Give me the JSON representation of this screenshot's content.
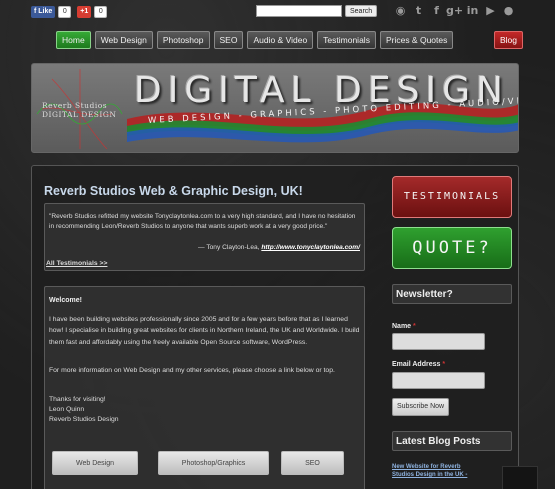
{
  "social_top": {
    "facebook": {
      "label": "Like",
      "count": "0"
    },
    "google_plus": {
      "label": "+1",
      "count": "0"
    }
  },
  "search": {
    "value": "",
    "button_label": "Search"
  },
  "social_icons": [
    {
      "name": "rss-icon",
      "glyph": "◉"
    },
    {
      "name": "twitter-icon",
      "glyph": "t"
    },
    {
      "name": "facebook-icon",
      "glyph": "f"
    },
    {
      "name": "google-plus-icon",
      "glyph": "g+"
    },
    {
      "name": "linkedin-icon",
      "glyph": "in"
    },
    {
      "name": "youtube-icon",
      "glyph": "▶"
    },
    {
      "name": "flickr-icon",
      "glyph": "●"
    }
  ],
  "nav": {
    "items": [
      "Home",
      "Web Design",
      "Photoshop",
      "SEO",
      "Audio & Video",
      "Testimonials",
      "Prices & Quotes"
    ],
    "active": "Home",
    "blog": "Blog"
  },
  "banner": {
    "logo_line1": "Reverb Studios",
    "logo_line2": "DIGITAL DESIGN",
    "title": "DIGITAL DESIGN",
    "tagline": "WEB DESIGN - GRAPHICS - PHOTO EDITING - AUDIO/VIDEO"
  },
  "main": {
    "heading": "Reverb Studios Web & Graphic Design, UK!",
    "testimonial": {
      "quote": "\"Reverb Studios refitted my website Tonyclaytonlea.com to a very high standard, and I have no hesitation in recommending Leon/Reverb Studios to anyone that wants superb work at a very good price.\"",
      "author": "— Tony Clayton-Lea,",
      "link": "http://www.tonyclaytonlea.com/"
    },
    "all_testimonials": "All Testimonials >>",
    "welcome": {
      "title": "Welcome!",
      "p1": "I have been building websites professionally since 2005 and for a few years before that as I learned how! I specialise in building great websites for clients in Northern Ireland, the UK and Worldwide. I build them fast and affordably using the freely available Open Source software, WordPress.",
      "p2": "For more information on Web Design and my other services, please choose a link below or top.",
      "p3": [
        "Thanks for visiting!",
        "Leon Quinn",
        "Reverb Studios Design"
      ]
    },
    "buttons": [
      "Web Design",
      "Photoshop/Graphics",
      "SEO"
    ]
  },
  "sidebar": {
    "testimonials_btn": "TESTIMONIALS",
    "quote_btn": "QUOTE?",
    "newsletter_heading": "Newsletter?",
    "name_label": "Name",
    "email_label": "Email Address",
    "subscribe": "Subscribe Now",
    "blog_heading": "Latest Blog Posts",
    "blog_post": "New Website for Reverb Studios Design in the UK -"
  }
}
